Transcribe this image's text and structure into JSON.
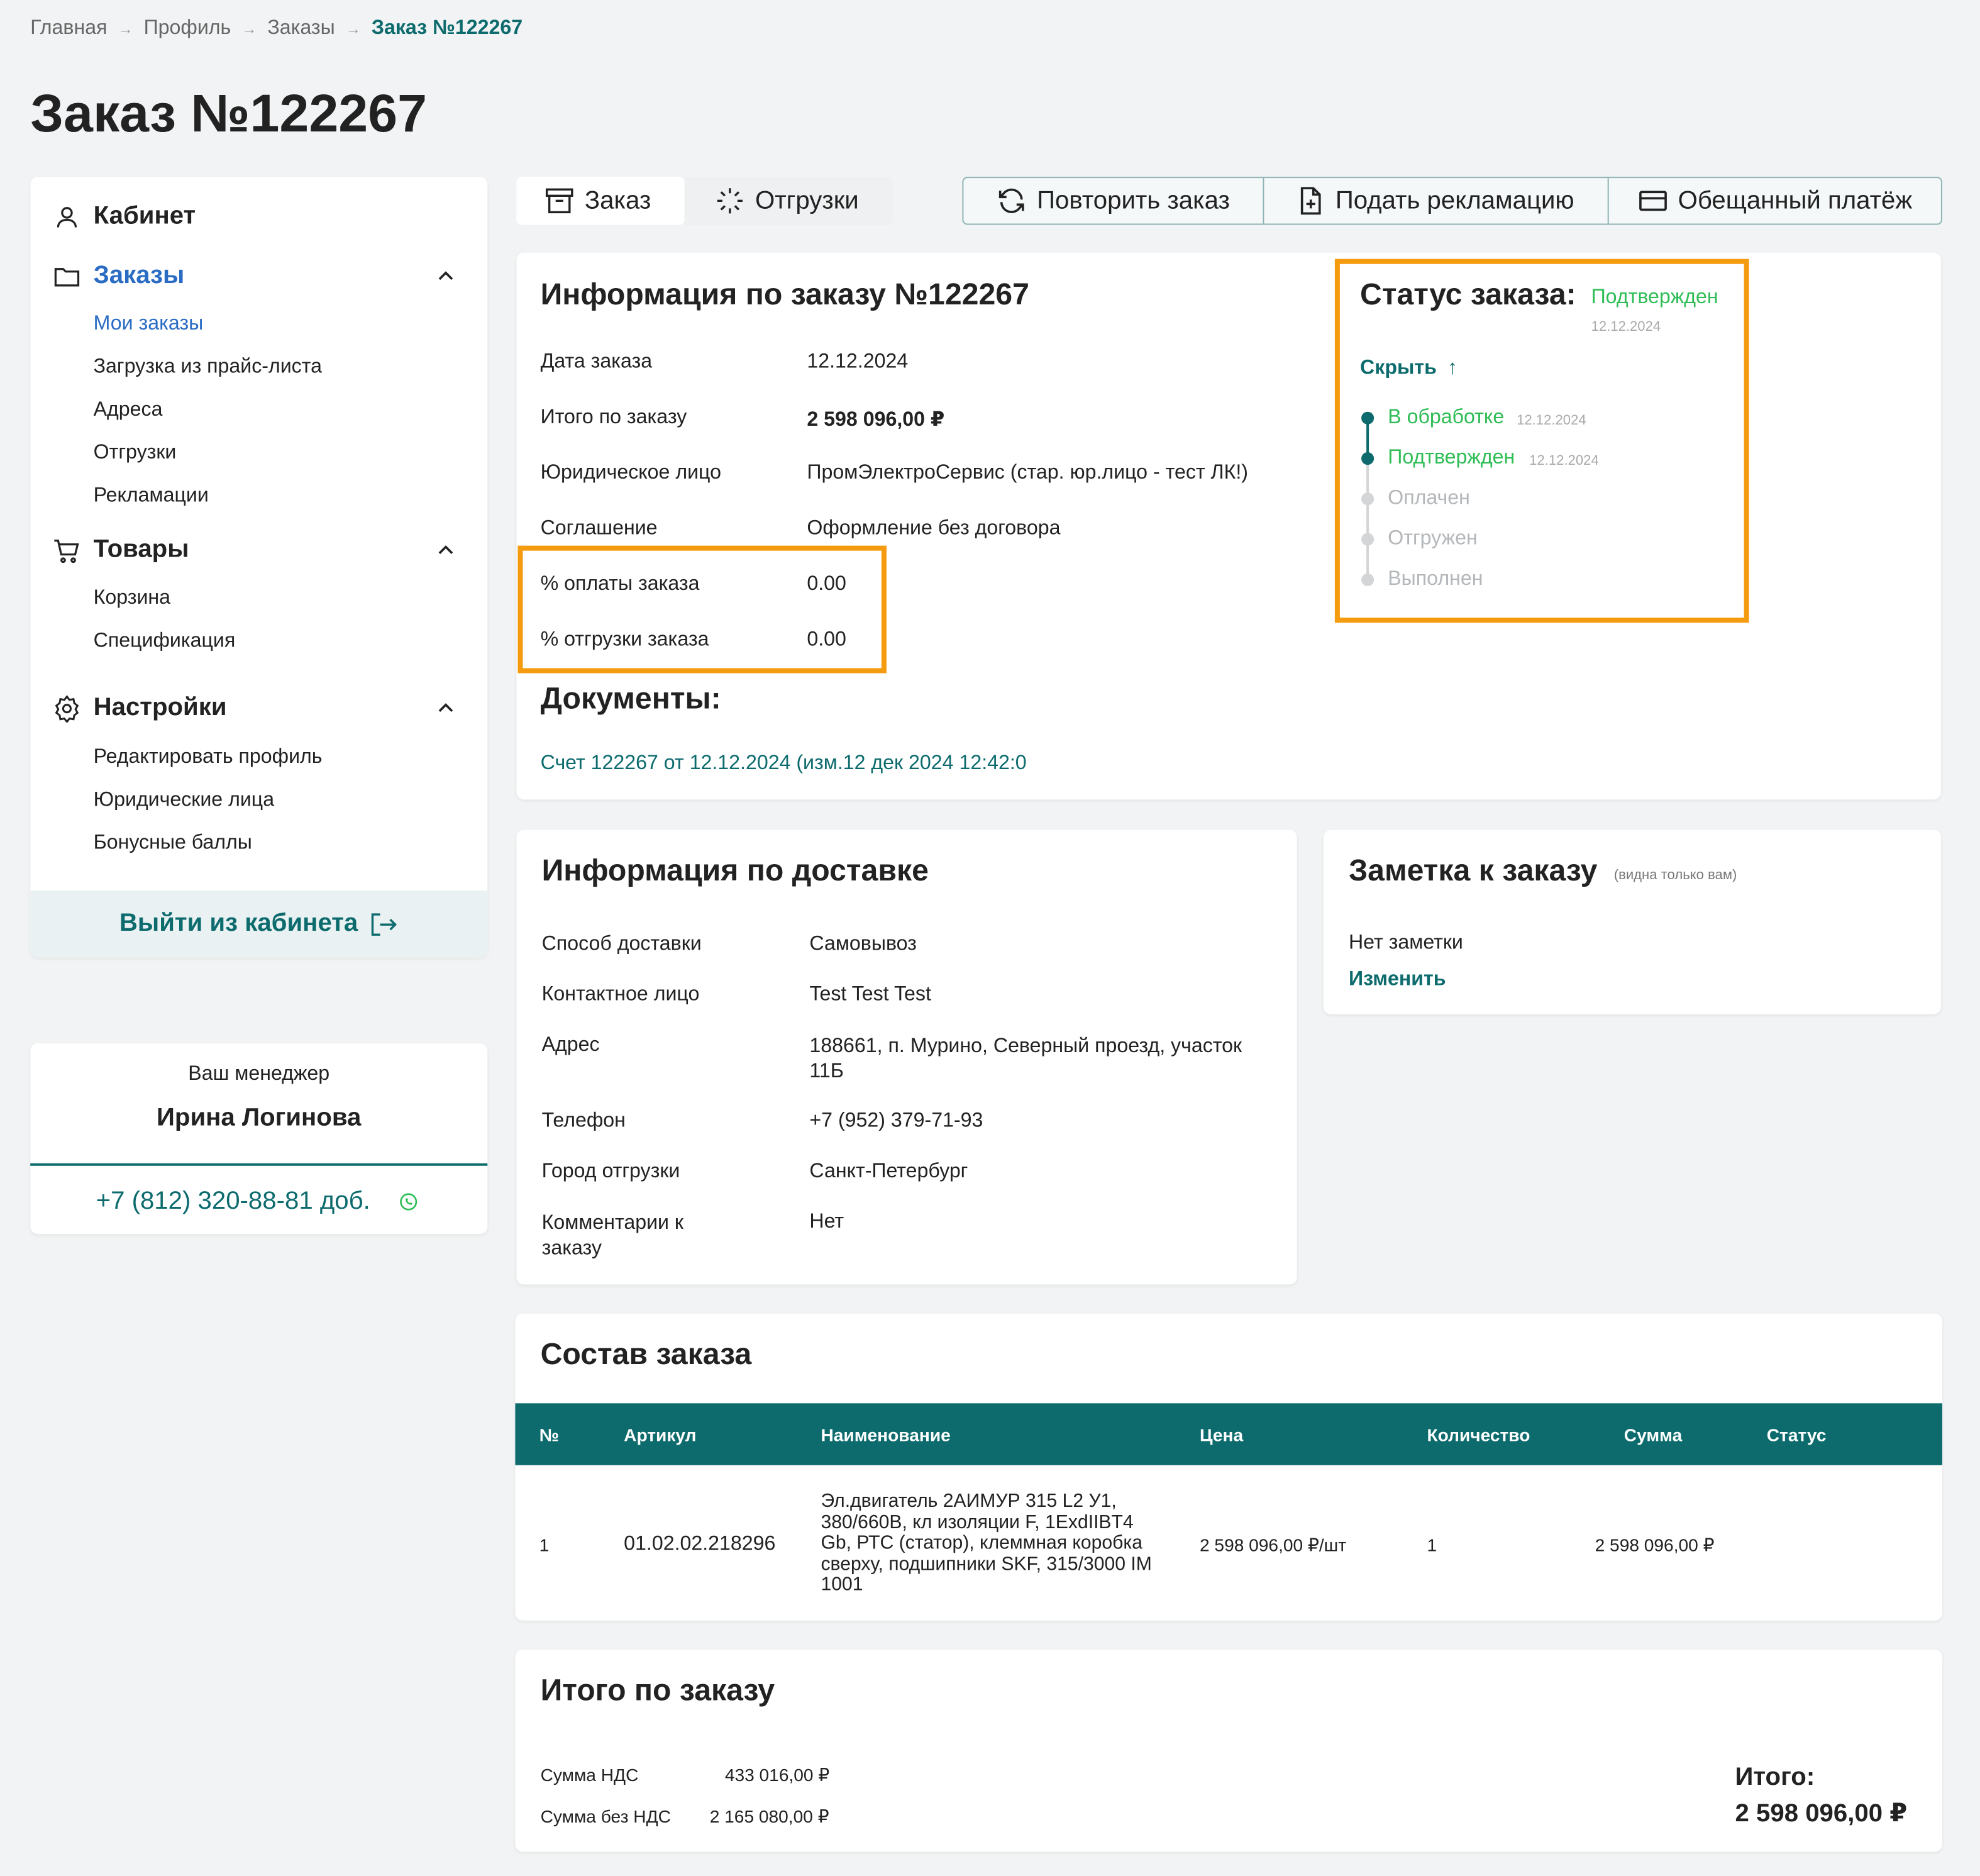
{
  "breadcrumb": [
    "Главная",
    "Профиль",
    "Заказы",
    "Заказ №122267"
  ],
  "page_title": "Заказ №122267",
  "sidebar": {
    "cabinet": "Кабинет",
    "groups": [
      {
        "label": "Заказы",
        "items": [
          "Мои заказы",
          "Загрузка из прайс-листа",
          "Адреса",
          "Отгрузки",
          "Рекламации"
        ]
      },
      {
        "label": "Товары",
        "items": [
          "Корзина",
          "Спецификация"
        ]
      },
      {
        "label": "Настройки",
        "items": [
          "Редактировать профиль",
          "Юридические лица",
          "Бонусные баллы"
        ]
      }
    ],
    "logout": "Выйти из кабинета"
  },
  "manager": {
    "caption": "Ваш менеджер",
    "name": "Ирина Логинова",
    "phone": "+7 (812) 320-88-81 доб."
  },
  "tabs": [
    "Заказ",
    "Отгрузки"
  ],
  "actions": [
    "Повторить заказ",
    "Подать рекламацию",
    "Обещанный платёж"
  ],
  "order_info": {
    "title": "Информация по заказу №122267",
    "rows": [
      {
        "label": "Дата заказа",
        "value": "12.12.2024"
      },
      {
        "label": "Итого по заказу",
        "value": "2 598 096,00 ₽"
      },
      {
        "label": "Юридическое лицо",
        "value": "ПромЭлектроСервис (стар. юр.лицо - тест ЛК!)"
      },
      {
        "label": "Соглашение",
        "value": "Оформление без договора"
      },
      {
        "label": "% оплаты заказа",
        "value": "0.00"
      },
      {
        "label": "% отгрузки заказа",
        "value": "0.00"
      }
    ],
    "documents_title": "Документы:",
    "document_link": "Счет 122267 от 12.12.2024 (изм.12 дек 2024 12:42:0"
  },
  "status": {
    "title": "Статус заказа:",
    "current": "Подтвержден",
    "current_date": "12.12.2024",
    "toggle": "Скрыть",
    "steps": [
      {
        "label": "В обработке",
        "date": "12.12.2024",
        "done": true
      },
      {
        "label": "Подтвержден",
        "date": "12.12.2024",
        "done": true
      },
      {
        "label": "Оплачен",
        "date": "",
        "done": false
      },
      {
        "label": "Отгружен",
        "date": "",
        "done": false
      },
      {
        "label": "Выполнен",
        "date": "",
        "done": false
      }
    ],
    "colors": {
      "done": "#2ebd55",
      "dot": "#0d6b6e",
      "pending": "#b4b7ba",
      "highlight": "#f59b0f"
    }
  },
  "delivery": {
    "title": "Информация по доставке",
    "rows": [
      {
        "label": "Способ доставки",
        "value": "Самовывоз"
      },
      {
        "label": "Контактное лицо",
        "value": "Test Test Test"
      },
      {
        "label": "Адрес",
        "value": "188661, п. Мурино, Северный проезд, участок 11Б"
      },
      {
        "label": "Телефон",
        "value": "+7 (952) 379-71-93"
      },
      {
        "label": "Город отгрузки",
        "value": "Санкт-Петербург"
      },
      {
        "label": "Комментарии к заказу",
        "value": "Нет"
      }
    ]
  },
  "note": {
    "title": "Заметка к заказу",
    "hint": "(видна только вам)",
    "text": "Нет заметки",
    "edit": "Изменить"
  },
  "composition": {
    "title": "Состав заказа",
    "columns": [
      "№",
      "Артикул",
      "Наименование",
      "Цена",
      "Количество",
      "Сумма",
      "Статус"
    ],
    "rows": [
      {
        "num": "1",
        "article": "01.02.02.218296",
        "name": "Эл.двигатель 2АИМУР 315 L2 У1, 380/660В, кл изоляции F, 1ExdIIBT4 Gb, РТС (статор), клеммная коробка сверху, подшипники SKF, 315/3000 IM 1001",
        "price": "2 598 096,00 ₽/шт",
        "qty": "1",
        "sum": "2 598 096,00 ₽",
        "status": ""
      }
    ]
  },
  "totals": {
    "title": "Итого по заказу",
    "vat_label": "Сумма НДС",
    "vat_value": "433 016,00 ₽",
    "novat_label": "Сумма без НДС",
    "novat_value": "2 165 080,00 ₽",
    "total_label": "Итого:",
    "total_value": "2 598 096,00 ₽"
  },
  "colors": {
    "accent": "#0d6b6e",
    "link_blue": "#2a6cc4",
    "background": "#f1f3f4"
  }
}
